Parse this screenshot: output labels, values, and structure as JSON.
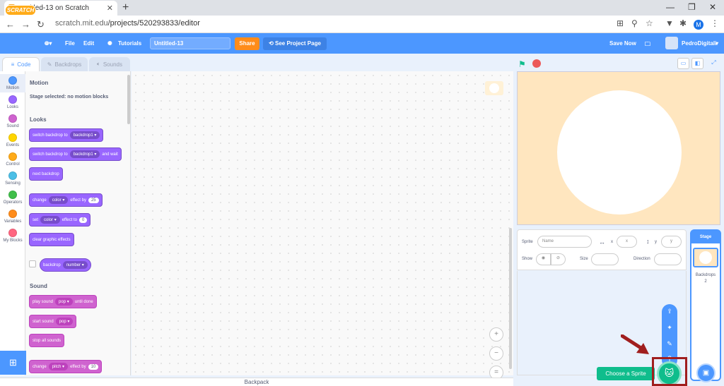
{
  "browser": {
    "tab_title": "Untitled-13 on Scratch",
    "url_prefix": "scratch.mit.edu",
    "url_path": "/projects/520293833/editor",
    "profile_initial": "M"
  },
  "menubar": {
    "logo": "SCRATCH",
    "file": "File",
    "edit": "Edit",
    "tutorials": "Tutorials",
    "project_title": "Untitled-13",
    "share": "Share",
    "see_project_page": "See Project Page",
    "save_now": "Save Now",
    "username": "PedroDigitali"
  },
  "editor_tabs": {
    "code": "Code",
    "backdrops": "Backdrops",
    "sounds": "Sounds"
  },
  "categories": [
    {
      "label": "Motion",
      "color": "#4c97ff"
    },
    {
      "label": "Looks",
      "color": "#9966ff"
    },
    {
      "label": "Sound",
      "color": "#cf63cf"
    },
    {
      "label": "Events",
      "color": "#ffd500"
    },
    {
      "label": "Control",
      "color": "#ffab19"
    },
    {
      "label": "Sensing",
      "color": "#4cbfe6"
    },
    {
      "label": "Operators",
      "color": "#40bf4a"
    },
    {
      "label": "Variables",
      "color": "#ff8c1a"
    },
    {
      "label": "My Blocks",
      "color": "#ff6680"
    }
  ],
  "palette": {
    "motion_head": "Motion",
    "motion_note": "Stage selected: no motion blocks",
    "looks_head": "Looks",
    "sound_head": "Sound",
    "blocks": {
      "switch_backdrop": "switch backdrop to",
      "backdrop1": "backdrop1",
      "switch_backdrop_wait": "switch backdrop to",
      "and_wait": "and wait",
      "next_backdrop": "next backdrop",
      "change": "change",
      "color": "color",
      "effect_by": "effect by",
      "change_val": "25",
      "set": "set",
      "effect_to": "effect to",
      "set_val": "0",
      "clear_effects": "clear graphic effects",
      "backdrop": "backdrop",
      "number": "number",
      "play_sound": "play sound",
      "pop": "pop",
      "until_done": "until done",
      "start_sound": "start sound",
      "stop_all": "stop all sounds",
      "pitch": "pitch",
      "pitch_val": "10"
    }
  },
  "backpack": "Backpack",
  "sprite_info": {
    "sprite_label": "Sprite",
    "name_placeholder": "Name",
    "x_label": "x",
    "x_placeholder": "x",
    "y_label": "y",
    "y_placeholder": "y",
    "show_label": "Show",
    "size_label": "Size",
    "direction_label": "Direction"
  },
  "stage_panel": {
    "title": "Stage",
    "backdrops_label": "Backdrops",
    "backdrops_count": "2"
  },
  "choose_sprite": "Choose a Sprite"
}
